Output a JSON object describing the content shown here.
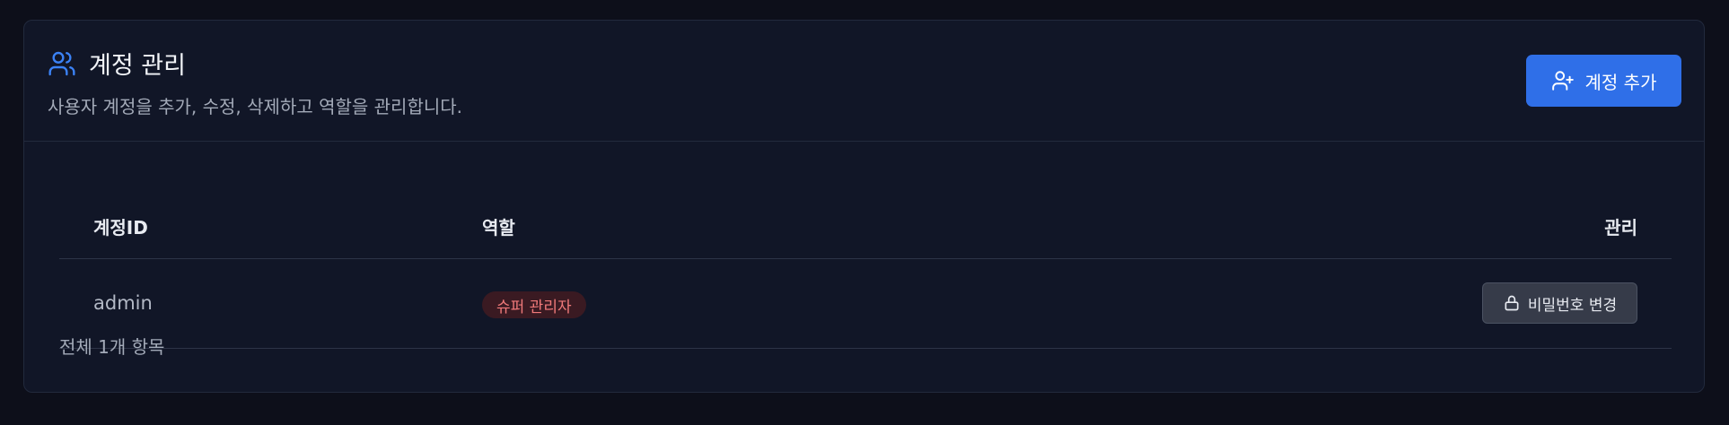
{
  "header": {
    "title": "계정 관리",
    "subtitle": "사용자 계정을 추가, 수정, 삭제하고 역할을 관리합니다.",
    "title_icon": "users-icon",
    "add_button_label": "계정 추가",
    "add_button_icon": "user-plus-icon"
  },
  "table": {
    "columns": [
      "계정ID",
      "역할",
      "관리"
    ],
    "rows": [
      {
        "account_id": "admin",
        "role": "슈퍼 관리자",
        "action_label": "비밀번호 변경",
        "action_icon": "lock-icon"
      }
    ],
    "footer": "전체 1개 항목"
  },
  "colors": {
    "accent": "#2f6fe8",
    "role_badge_bg": "#3a1a22",
    "role_badge_text": "#f07a7a",
    "background": "#0d0f1a",
    "card": "#111627"
  }
}
